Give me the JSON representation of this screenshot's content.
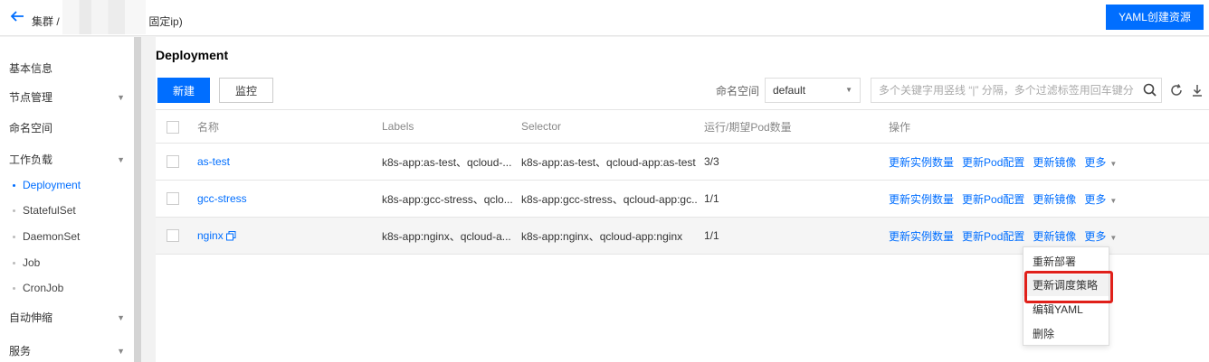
{
  "header": {
    "cluster_crumb": "集群 /",
    "crumb_suffix": "固定ip)",
    "yaml_button": "YAML创建资源"
  },
  "sidebar": {
    "items": [
      {
        "label": "基本信息"
      },
      {
        "label": "节点管理",
        "chevron": "▼"
      },
      {
        "label": "命名空间"
      },
      {
        "label": "工作负载",
        "chevron": "▼"
      },
      {
        "label": "自动伸缩",
        "chevron": "▼"
      },
      {
        "label": "服务",
        "chevron": "▼"
      }
    ],
    "workload_subitems": [
      {
        "label": "Deployment",
        "active": true
      },
      {
        "label": "StatefulSet"
      },
      {
        "label": "DaemonSet"
      },
      {
        "label": "Job"
      },
      {
        "label": "CronJob"
      }
    ]
  },
  "main": {
    "title": "Deployment",
    "new_button": "新建",
    "monitor_button": "监控",
    "namespace_label": "命名空间",
    "namespace_value": "default",
    "search_placeholder": "多个关键字用竖线 “|” 分隔，多个过滤标签用回车键分隔"
  },
  "table": {
    "headers": {
      "name": "名称",
      "labels": "Labels",
      "selector": "Selector",
      "pods": "运行/期望Pod数量",
      "ops": "操作"
    },
    "rows": [
      {
        "name": "as-test",
        "labels": "k8s-app:as-test、qcloud-...",
        "selector": "k8s-app:as-test、qcloud-app:as-test",
        "pods": "3/3"
      },
      {
        "name": "gcc-stress",
        "labels": "k8s-app:gcc-stress、qclo...",
        "selector": "k8s-app:gcc-stress、qcloud-app:gc...",
        "pods": "1/1"
      },
      {
        "name": "nginx",
        "labels": "k8s-app:nginx、qcloud-a...",
        "selector": "k8s-app:nginx、qcloud-app:nginx",
        "pods": "1/1"
      }
    ],
    "ops": {
      "update_replicas": "更新实例数量",
      "update_pod_config": "更新Pod配置",
      "update_image": "更新镜像",
      "more": "更多"
    }
  },
  "dropdown_menu": {
    "items": [
      "重新部署",
      "更新调度策略",
      "编辑YAML",
      "删除"
    ],
    "highlighted_index": 1
  },
  "colors": {
    "accent": "#006eff",
    "highlight_border": "#e0201a"
  }
}
